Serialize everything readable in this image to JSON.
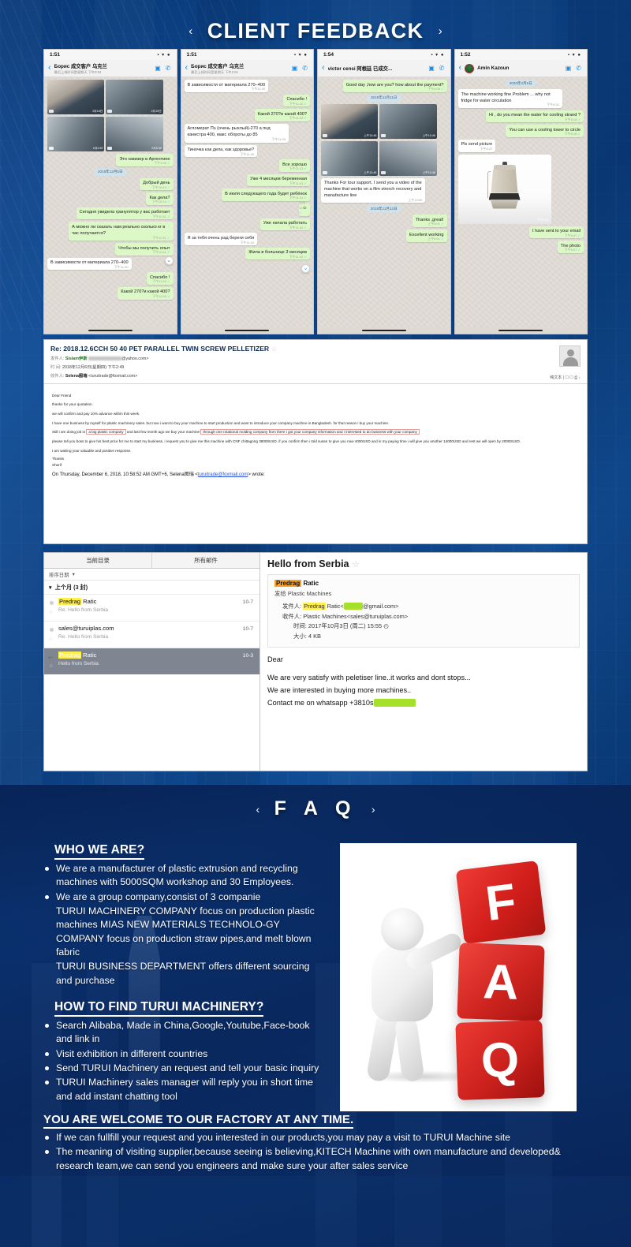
{
  "feedback": {
    "banner": {
      "title": "CLIENT FEEDBACK",
      "arrow_left": "‹",
      "arrow_right": "›"
    },
    "phones": [
      {
        "time": "1:51",
        "status_icons": "▪ ▾ ●",
        "contact": "Борис 成交客户 乌克兰",
        "subtitle": "最后上线时间是星期天 下午2:04",
        "messages": [
          {
            "type": "media-grid",
            "items": [
              {
                "dur": "2月18日",
                "cls": "photo1"
              },
              {
                "dur": "2月19日",
                "cls": "photo2"
              }
            ]
          },
          {
            "type": "media-grid",
            "items": [
              {
                "dur": "2月4:59",
                "cls": "photo3"
              },
              {
                "dur": "2月6:59",
                "cls": "photo4"
              }
            ]
          },
          {
            "type": "out",
            "text": "Это сквизер в Аргентине",
            "time": "下午1:05"
          },
          {
            "type": "day",
            "text": "2019年12月5日"
          },
          {
            "type": "out",
            "text": "Добрый день",
            "time": "下午10:10"
          },
          {
            "type": "out",
            "text": "Как дела?",
            "time": "下午10:10"
          },
          {
            "type": "out",
            "text": "Сегодня увидела гранулятор у вас работает",
            "time": "下午10:11"
          },
          {
            "type": "out",
            "text": "А можно ли сказать нам реально сколько кг в час получается?",
            "time": "下午10:11"
          },
          {
            "type": "out",
            "text": "Чтобы мы получить опыт",
            "time": "下午10:11"
          },
          {
            "type": "in",
            "text": "В зависимости от материала 270–400",
            "time": "下午11:30"
          },
          {
            "type": "out",
            "text": "Спасибо !",
            "time": "下午11:32"
          },
          {
            "type": "out",
            "text": "Какой 270?и какой 400?",
            "time": "下午11:33"
          }
        ]
      },
      {
        "time": "1:51",
        "status_icons": "▪ ▾ ●",
        "contact": "Борис 成交客户 乌克兰",
        "subtitle": "最后上线时间是星期天 下午2:04",
        "messages": [
          {
            "type": "in",
            "text": "В зависимости от материала 270–400",
            "time": "下午11:30"
          },
          {
            "type": "out",
            "text": "Спасибо !",
            "time": "下午11:32"
          },
          {
            "type": "out",
            "text": "Какой 270?и какой 400?",
            "time": "下午11:33"
          },
          {
            "type": "in",
            "text": "Агломерат Пэ (очень рыхлый)-270 а пнд канистра 400, макс обороты до 85",
            "time": "下午11:39"
          },
          {
            "type": "in",
            "text": "Тиночка как дела, как здоровье?",
            "time": "下午11:40"
          },
          {
            "type": "out",
            "text": "Все хорошо",
            "time": "下午11:41"
          },
          {
            "type": "out",
            "text": "Уже 4 месяцев беременная",
            "time": "下午11:41"
          },
          {
            "type": "out",
            "text": "В июля следующего года будет ребёнок",
            "time": "下午11:41"
          },
          {
            "type": "out",
            "text": "☺",
            "time": "下午11:42"
          },
          {
            "type": "out",
            "text": "Уже начала работать",
            "time": "下午11:42"
          },
          {
            "type": "in",
            "text": "Я за тебя очень рад береги себя",
            "time": "下午11:42"
          },
          {
            "type": "out",
            "text": "Жила в больнице 3 месяцев",
            "time": "下午11:42"
          }
        ]
      },
      {
        "time": "1:54",
        "status_icons": "▪ ▾ ●",
        "contact": "victor censi 阿根廷 已成交...",
        "subtitle": "",
        "messages": [
          {
            "type": "out",
            "text": "Good day ,how are you? how about the payment?",
            "time": "下午4:08"
          },
          {
            "type": "day",
            "text": "2019年11月11日"
          },
          {
            "type": "media-grid",
            "items": [
              {
                "dur": "上午10:48",
                "cls": "photo1"
              },
              {
                "dur": "上午10:48",
                "cls": "photo2"
              }
            ]
          },
          {
            "type": "media-grid",
            "items": [
              {
                "dur": "上午10:48",
                "cls": "photo3"
              },
              {
                "dur": "上午10:48",
                "cls": "photo4"
              }
            ]
          },
          {
            "type": "in",
            "text": "Thanks For tour support. I send you a video of the machine that works on a film strerch recovery and manufacture line",
            "time": "上午10:50"
          },
          {
            "type": "day",
            "text": "2019年11月12日"
          },
          {
            "type": "out",
            "text": "Thanks ,great!",
            "time": "上午9:01"
          },
          {
            "type": "out",
            "text": "Excellent working",
            "time": "上午9:01"
          }
        ]
      },
      {
        "time": "1:52",
        "status_icons": "▪ ▾ ●",
        "contact": "Amin Kazoun",
        "subtitle": "",
        "messages": [
          {
            "type": "day",
            "text": "2020年2月6日"
          },
          {
            "type": "in",
            "text": "The machine working fine Problem ... why not fridge for water circulation",
            "time": "下午5:30"
          },
          {
            "type": "out",
            "text": "Hi , do you mean the water for cooling strand ?",
            "time": "下午5:18"
          },
          {
            "type": "out",
            "text": "You can use a cooling tower to circle",
            "time": "下午5:18"
          },
          {
            "type": "in",
            "text": "Pls send picture",
            "time": "下午5:37"
          },
          {
            "type": "product-image",
            "dur": "下午5:39"
          },
          {
            "type": "out",
            "text": "I have sent to your email",
            "time": "下午5:47"
          },
          {
            "type": "out",
            "text": "The photo",
            "time": "下午5:47"
          }
        ]
      }
    ]
  },
  "email1": {
    "subject": "Re: 2018.12.6CCH 50 40 PET PARALLEL TWIN SCREW PELLETIZER",
    "star": "☆",
    "from_label": "发件人:",
    "from_name": "Sislam伊斯",
    "from_addr": "@yahoo.com>",
    "date_label": "时  间:",
    "date_value": "2018年12月6日(星期四) 下午2:49",
    "to_label": "收件人:",
    "to_name": "Selena图瑞",
    "to_addr": "<turuitrade@foxmail.com>",
    "tools": "纯文本 | ☐ ☐ ⎙ ↓",
    "body": [
      "Dear Friend",
      "thanks for your quotation.",
      "we will confirm and pay 10% advance within this week.",
      "I have one business by myself for plastic machinery sales. but now i want to buy your machine to start production and want to introduce your company machine in Bangladesh. for that reason i buy your machine.",
      "Still i am doing job in a big plastic company and last few month ago we buy your machine through one rotational molding company from there i got your company information and i interested to do business with your company.",
      "please tell you boss to give his best price for me to start my business. i request you to give me this machine with CNF chittagong 38000USD. if you confirm then i told susan to give you now 4000USD and in my paying time i will give you another 14000USD and rest we will open by 20000USD.",
      "I am waiting your valuable and positive response.",
      "Thanks",
      "Sherif"
    ],
    "quote_line_prefix": "On Thursday, December 6, 2018, 10:58:52 AM GMT+6, Selena图瑞 <",
    "quote_link": "turuitrade@foxmail.com",
    "quote_line_suffix": "> wrote:"
  },
  "email2": {
    "tabs": [
      "当前目录",
      "所有邮件"
    ],
    "sort_label": "排序日期",
    "sort_caret": "▾",
    "group_caret": "▾",
    "group_label": "上个月 (3 封)",
    "rows": [
      {
        "from_hl": "Predrag",
        "from_rest": " Ratic",
        "subject": "Re: Hello from Serbia",
        "date": "10-7",
        "selected": false,
        "replied": false
      },
      {
        "from_hl": "",
        "from_rest": "sales@turuiplas.com",
        "subject": "Re: Hello from Serbia",
        "date": "10-7",
        "selected": false,
        "replied": false
      },
      {
        "from_hl": "Predrag",
        "from_rest": " Ratic",
        "subject": "Hello from Serbia",
        "date": "10-3",
        "selected": true,
        "replied": true
      }
    ],
    "view": {
      "title": "Hello from Serbia",
      "star": "☆",
      "sender_hl": "Predrag",
      "sender_rest": " Ratic",
      "sender_to": "发给 Plastic Machines",
      "field_from_label": "发件人:",
      "field_from_name": "Predrag",
      "field_from_rest": " Ratic<",
      "field_from_domain": "@gmail.com>",
      "field_to_label": "收件人:",
      "field_to_value": "Plastic Machines<sales@turuiplas.com>",
      "field_time_label": "时间:",
      "field_time_value": "2017年10月3日 (周二) 15:55",
      "field_time_icon": "◴",
      "field_size_label": "大小:",
      "field_size_value": "4 KB",
      "body": [
        "Dear",
        "",
        "We are very satisfy with peletiser line..it works and dont stops...",
        "We are interested in buying more machines..",
        "Contact me on whatsapp +3810ѕ"
      ]
    }
  },
  "faq": {
    "banner": {
      "title": "F A Q",
      "arrow_left": "‹",
      "arrow_right": "›"
    },
    "sections": [
      {
        "heading": "WHO WE ARE?",
        "items": [
          {
            "bullet": true,
            "text": "We are a manufacturer of plastic extrusion and recycling machines with 5000SQM workshop and 30 Employees."
          },
          {
            "bullet": true,
            "text": "We are a group company,consist of 3 companie"
          },
          {
            "bullet": false,
            "text": "TURUI MACHINERY COMPANY focus on production plastic machines MIAS NEW MATERIALS TECHNOLO-GY COMPANY focus on production straw pipes,and melt blown fabric"
          },
          {
            "bullet": false,
            "text": "TURUI BUSINESS DEPARTMENT offers different sourcing and purchase"
          }
        ]
      },
      {
        "heading": "HOW TO FIND TURUI MACHINERY?",
        "items": [
          {
            "bullet": true,
            "text": "Search Alibaba, Made in China,Google,Youtube,Face-book and link in"
          },
          {
            "bullet": true,
            "text": "Visit exhibition in different countries"
          },
          {
            "bullet": true,
            "text": "Send TURUI Machinery an request and tell your basic inquiry"
          },
          {
            "bullet": true,
            "text": "TURUI Machinery sales manager will reply you in short time and add instant chatting tool"
          }
        ]
      }
    ],
    "bottom": {
      "heading": "YOU ARE WELCOME TO OUR FACTORY AT ANY TIME.",
      "items": [
        {
          "bullet": true,
          "text": "If we can fullfill your request and you interested in our products,you may pay a visit to TURUI Machine site"
        },
        {
          "bullet": true,
          "text": "The meaning of visiting supplier,because seeing is believing,KITECH Machine with own manufacture and developed& research team,we can send you engineers and make sure your after sales service"
        }
      ]
    },
    "image": {
      "letters": [
        "F",
        "A",
        "Q"
      ]
    }
  }
}
